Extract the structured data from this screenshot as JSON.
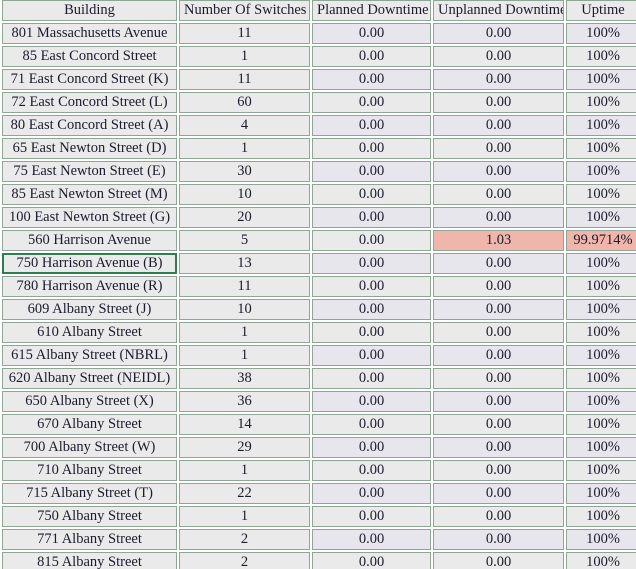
{
  "table": {
    "name": "building-switch-uptime-table",
    "columns": [
      {
        "key": "building",
        "label": "Building"
      },
      {
        "key": "switches",
        "label": "Number Of Switches"
      },
      {
        "key": "planned",
        "label": "Planned Downtime"
      },
      {
        "key": "unplanned",
        "label": "Unplanned Downtime"
      },
      {
        "key": "uptime",
        "label": "Uptime"
      }
    ],
    "rows": [
      {
        "building": "801 Massachusetts Avenue",
        "switches": "11",
        "planned": "0.00",
        "unplanned": "0.00",
        "uptime": "100%"
      },
      {
        "building": "85 East Concord Street",
        "switches": "1",
        "planned": "0.00",
        "unplanned": "0.00",
        "uptime": "100%"
      },
      {
        "building": "71 East Concord Street (K)",
        "switches": "11",
        "planned": "0.00",
        "unplanned": "0.00",
        "uptime": "100%"
      },
      {
        "building": "72 East Concord Street (L)",
        "switches": "60",
        "planned": "0.00",
        "unplanned": "0.00",
        "uptime": "100%"
      },
      {
        "building": "80 East Concord Street (A)",
        "switches": "4",
        "planned": "0.00",
        "unplanned": "0.00",
        "uptime": "100%"
      },
      {
        "building": "65 East Newton Street (D)",
        "switches": "1",
        "planned": "0.00",
        "unplanned": "0.00",
        "uptime": "100%"
      },
      {
        "building": "75 East Newton Street (E)",
        "switches": "30",
        "planned": "0.00",
        "unplanned": "0.00",
        "uptime": "100%"
      },
      {
        "building": "85 East Newton Street (M)",
        "switches": "10",
        "planned": "0.00",
        "unplanned": "0.00",
        "uptime": "100%"
      },
      {
        "building": "100 East Newton Street (G)",
        "switches": "20",
        "planned": "0.00",
        "unplanned": "0.00",
        "uptime": "100%"
      },
      {
        "building": "560 Harrison Avenue",
        "switches": "5",
        "planned": "0.00",
        "unplanned": "1.03",
        "uptime": "99.9714%",
        "alert_cells": [
          "unplanned",
          "uptime"
        ]
      },
      {
        "building": "750 Harrison Avenue (B)",
        "switches": "13",
        "planned": "0.00",
        "unplanned": "0.00",
        "uptime": "100%",
        "selected_cells": [
          "building"
        ]
      },
      {
        "building": "780 Harrison Avenue (R)",
        "switches": "11",
        "planned": "0.00",
        "unplanned": "0.00",
        "uptime": "100%"
      },
      {
        "building": "609 Albany Street (J)",
        "switches": "10",
        "planned": "0.00",
        "unplanned": "0.00",
        "uptime": "100%"
      },
      {
        "building": "610 Albany Street",
        "switches": "1",
        "planned": "0.00",
        "unplanned": "0.00",
        "uptime": "100%"
      },
      {
        "building": "615 Albany Street (NBRL)",
        "switches": "1",
        "planned": "0.00",
        "unplanned": "0.00",
        "uptime": "100%"
      },
      {
        "building": "620 Albany Street (NEIDL)",
        "switches": "38",
        "planned": "0.00",
        "unplanned": "0.00",
        "uptime": "100%"
      },
      {
        "building": "650 Albany Street (X)",
        "switches": "36",
        "planned": "0.00",
        "unplanned": "0.00",
        "uptime": "100%"
      },
      {
        "building": "670 Albany Street",
        "switches": "14",
        "planned": "0.00",
        "unplanned": "0.00",
        "uptime": "100%"
      },
      {
        "building": "700 Albany Street (W)",
        "switches": "29",
        "planned": "0.00",
        "unplanned": "0.00",
        "uptime": "100%"
      },
      {
        "building": "710 Albany Street",
        "switches": "1",
        "planned": "0.00",
        "unplanned": "0.00",
        "uptime": "100%"
      },
      {
        "building": "715 Albany Street (T)",
        "switches": "22",
        "planned": "0.00",
        "unplanned": "0.00",
        "uptime": "100%"
      },
      {
        "building": "750 Albany Street",
        "switches": "1",
        "planned": "0.00",
        "unplanned": "0.00",
        "uptime": "100%"
      },
      {
        "building": "771 Albany Street",
        "switches": "2",
        "planned": "0.00",
        "unplanned": "0.00",
        "uptime": "100%"
      },
      {
        "building": "815 Albany Street",
        "switches": "2",
        "planned": "0.00",
        "unplanned": "0.00",
        "uptime": "100%"
      }
    ]
  },
  "colors": {
    "cell_border": "#8fa596",
    "cell_background": "#eaeaea",
    "cell_background_tint": "#e8e6ed",
    "alert_background": "#f0b6ac",
    "selected_border": "#2e7d4f",
    "text": "#1a1b2e"
  }
}
